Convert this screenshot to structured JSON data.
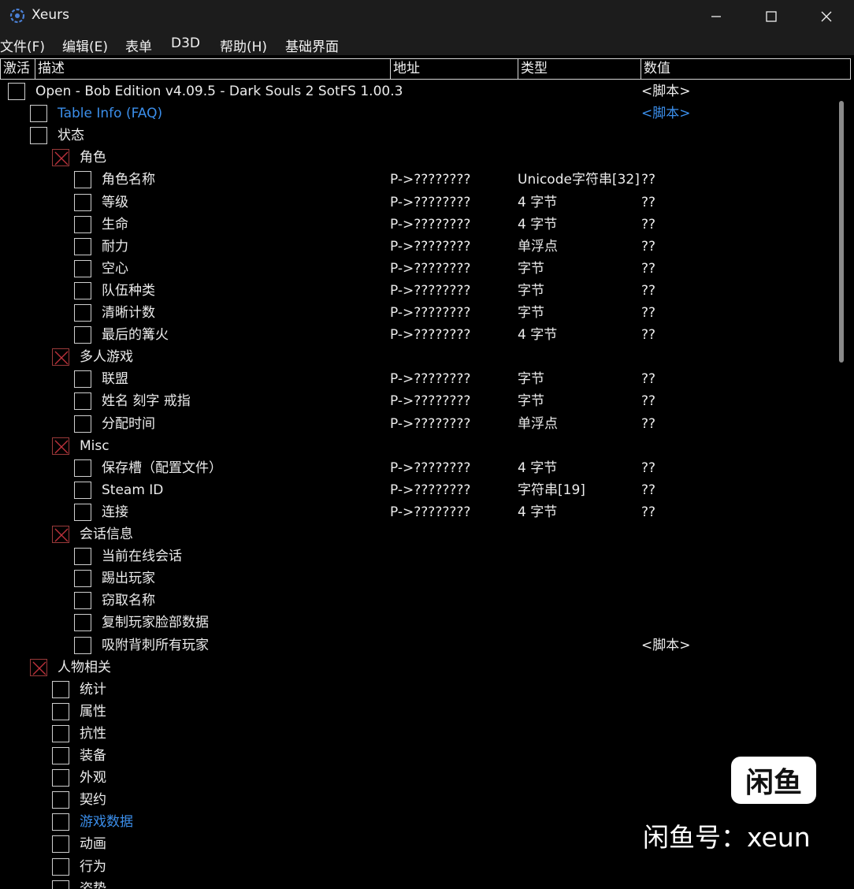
{
  "window": {
    "title": "Xeurs",
    "minimize_glyph": "—",
    "maximize_glyph": "☐",
    "close_glyph": "✕"
  },
  "menu": [
    {
      "label": "文件(F)"
    },
    {
      "label": "编辑(E)"
    },
    {
      "label": "表单"
    },
    {
      "label": "D3D"
    },
    {
      "label": "帮助(H)"
    },
    {
      "label": "基础界面"
    }
  ],
  "columns": {
    "active": "激活",
    "description": "描述",
    "address": "地址",
    "type": "类型",
    "value": "数值"
  },
  "colors": {
    "link_blue": "#3b8eea",
    "check_red": "#c0323c",
    "background": "#000000"
  },
  "rows": [
    {
      "level": 0,
      "checked": false,
      "desc": "Open - Bob Edition v4.09.5 - Dark Souls 2 SotFS 1.00.3",
      "addr": "",
      "type": "",
      "value": "<脚本>",
      "blue": false
    },
    {
      "level": 1,
      "checked": false,
      "desc": "Table Info (FAQ)",
      "addr": "",
      "type": "",
      "value": "<脚本>",
      "blue": true
    },
    {
      "level": 1,
      "checked": false,
      "desc": "状态",
      "addr": "",
      "type": "",
      "value": "",
      "blue": false
    },
    {
      "level": 2,
      "checked": true,
      "desc": "角色",
      "addr": "",
      "type": "",
      "value": "",
      "blue": false
    },
    {
      "level": 3,
      "checked": false,
      "desc": "角色名称",
      "addr": "P->????????",
      "type": "Unicode字符串[32]",
      "value": "??",
      "blue": false
    },
    {
      "level": 3,
      "checked": false,
      "desc": "等级",
      "addr": "P->????????",
      "type": "4 字节",
      "value": "??",
      "blue": false
    },
    {
      "level": 3,
      "checked": false,
      "desc": "生命",
      "addr": "P->????????",
      "type": "4 字节",
      "value": "??",
      "blue": false
    },
    {
      "level": 3,
      "checked": false,
      "desc": "耐力",
      "addr": "P->????????",
      "type": "单浮点",
      "value": "??",
      "blue": false
    },
    {
      "level": 3,
      "checked": false,
      "desc": "空心",
      "addr": "P->????????",
      "type": "字节",
      "value": "??",
      "blue": false
    },
    {
      "level": 3,
      "checked": false,
      "desc": "队伍种类",
      "addr": "P->????????",
      "type": "字节",
      "value": "??",
      "blue": false
    },
    {
      "level": 3,
      "checked": false,
      "desc": "清晰计数",
      "addr": "P->????????",
      "type": "字节",
      "value": "??",
      "blue": false
    },
    {
      "level": 3,
      "checked": false,
      "desc": "最后的篝火",
      "addr": "P->????????",
      "type": "4 字节",
      "value": "??",
      "blue": false
    },
    {
      "level": 2,
      "checked": true,
      "desc": "多人游戏",
      "addr": "",
      "type": "",
      "value": "",
      "blue": false
    },
    {
      "level": 3,
      "checked": false,
      "desc": "联盟",
      "addr": "P->????????",
      "type": "字节",
      "value": "??",
      "blue": false
    },
    {
      "level": 3,
      "checked": false,
      "desc": "姓名 刻字 戒指",
      "addr": "P->????????",
      "type": "字节",
      "value": "??",
      "blue": false
    },
    {
      "level": 3,
      "checked": false,
      "desc": "分配时间",
      "addr": "P->????????",
      "type": "单浮点",
      "value": "??",
      "blue": false
    },
    {
      "level": 2,
      "checked": true,
      "desc": "Misc",
      "addr": "",
      "type": "",
      "value": "",
      "blue": false
    },
    {
      "level": 3,
      "checked": false,
      "desc": "保存槽（配置文件）",
      "addr": "P->????????",
      "type": "4 字节",
      "value": "??",
      "blue": false
    },
    {
      "level": 3,
      "checked": false,
      "desc": "Steam ID",
      "addr": "P->????????",
      "type": "字符串[19]",
      "value": "??",
      "blue": false
    },
    {
      "level": 3,
      "checked": false,
      "desc": "连接",
      "addr": "P->????????",
      "type": "4 字节",
      "value": "??",
      "blue": false
    },
    {
      "level": 2,
      "checked": true,
      "desc": "会话信息",
      "addr": "",
      "type": "",
      "value": "",
      "blue": false
    },
    {
      "level": 3,
      "checked": false,
      "desc": "当前在线会话",
      "addr": "",
      "type": "",
      "value": "",
      "blue": false
    },
    {
      "level": 3,
      "checked": false,
      "desc": "踢出玩家",
      "addr": "",
      "type": "",
      "value": "",
      "blue": false
    },
    {
      "level": 3,
      "checked": false,
      "desc": "窃取名称",
      "addr": "",
      "type": "",
      "value": "",
      "blue": false
    },
    {
      "level": 3,
      "checked": false,
      "desc": "复制玩家脸部数据",
      "addr": "",
      "type": "",
      "value": "",
      "blue": false
    },
    {
      "level": 3,
      "checked": false,
      "desc": "吸附背刺所有玩家",
      "addr": "",
      "type": "",
      "value": "<脚本>",
      "blue": false
    },
    {
      "level": 1,
      "checked": true,
      "desc": "人物相关",
      "addr": "",
      "type": "",
      "value": "",
      "blue": false
    },
    {
      "level": 2,
      "checked": false,
      "desc": "统计",
      "addr": "",
      "type": "",
      "value": "",
      "blue": false
    },
    {
      "level": 2,
      "checked": false,
      "desc": "属性",
      "addr": "",
      "type": "",
      "value": "",
      "blue": false
    },
    {
      "level": 2,
      "checked": false,
      "desc": "抗性",
      "addr": "",
      "type": "",
      "value": "",
      "blue": false
    },
    {
      "level": 2,
      "checked": false,
      "desc": "装备",
      "addr": "",
      "type": "",
      "value": "",
      "blue": false
    },
    {
      "level": 2,
      "checked": false,
      "desc": "外观",
      "addr": "",
      "type": "",
      "value": "",
      "blue": false
    },
    {
      "level": 2,
      "checked": false,
      "desc": "契约",
      "addr": "",
      "type": "",
      "value": "",
      "blue": false
    },
    {
      "level": 2,
      "checked": false,
      "desc": "游戏数据",
      "addr": "",
      "type": "",
      "value": "",
      "blue": true
    },
    {
      "level": 2,
      "checked": false,
      "desc": "动画",
      "addr": "",
      "type": "",
      "value": "",
      "blue": false
    },
    {
      "level": 2,
      "checked": false,
      "desc": "行为",
      "addr": "",
      "type": "",
      "value": "",
      "blue": false
    },
    {
      "level": 2,
      "checked": false,
      "desc": "姿势",
      "addr": "",
      "type": "",
      "value": "",
      "blue": false
    }
  ],
  "watermark": {
    "logo_text": "闲鱼",
    "caption": "闲鱼号：xeun"
  }
}
